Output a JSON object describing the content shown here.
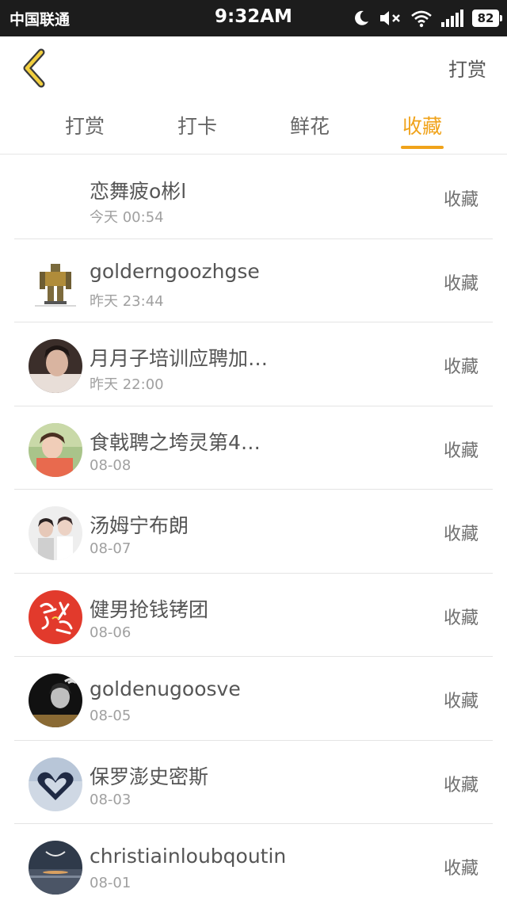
{
  "status_bar": {
    "carrier": "中国联通",
    "time": "9:32AM",
    "battery": "82",
    "icons": [
      "moon-icon",
      "mute-icon",
      "wifi-icon",
      "signal-icon",
      "battery-icon"
    ]
  },
  "header": {
    "back_icon": "chevron-left-icon",
    "action_label": "打赏"
  },
  "tabs": [
    {
      "label": "打赏",
      "active": false
    },
    {
      "label": "打卡",
      "active": false
    },
    {
      "label": "鲜花",
      "active": false
    },
    {
      "label": "收藏",
      "active": true
    }
  ],
  "list": [
    {
      "name": "恋舞疲o彬l",
      "time": "今天 00:54",
      "action": "收藏",
      "avatar": "none"
    },
    {
      "name": "golderngoozhgse",
      "time": "昨天 23:44",
      "action": "收藏",
      "avatar": "robot-figure"
    },
    {
      "name": "月月子培训应聘加…",
      "time": "昨天 22:00",
      "action": "收藏",
      "avatar": "portrait"
    },
    {
      "name": "食戟聘之垮灵第4…",
      "time": "08-08",
      "action": "收藏",
      "avatar": "portrait"
    },
    {
      "name": "汤姆宁布朗",
      "time": "08-07",
      "action": "收藏",
      "avatar": "portrait"
    },
    {
      "name": "健男抢钱铐团",
      "time": "08-06",
      "action": "收藏",
      "avatar": "red-calligraphy"
    },
    {
      "name": "goldenugoosve",
      "time": "08-05",
      "action": "收藏",
      "avatar": "portrait"
    },
    {
      "name": "保罗澎史密斯",
      "time": "08-03",
      "action": "收藏",
      "avatar": "hands-heart"
    },
    {
      "name": "christiainloubqoutin",
      "time": "08-01",
      "action": "收藏",
      "avatar": "landscape"
    }
  ],
  "colors": {
    "accent": "#f0a31b",
    "status_bar_bg": "#1c1c1c",
    "divider": "#e4e4e4"
  }
}
